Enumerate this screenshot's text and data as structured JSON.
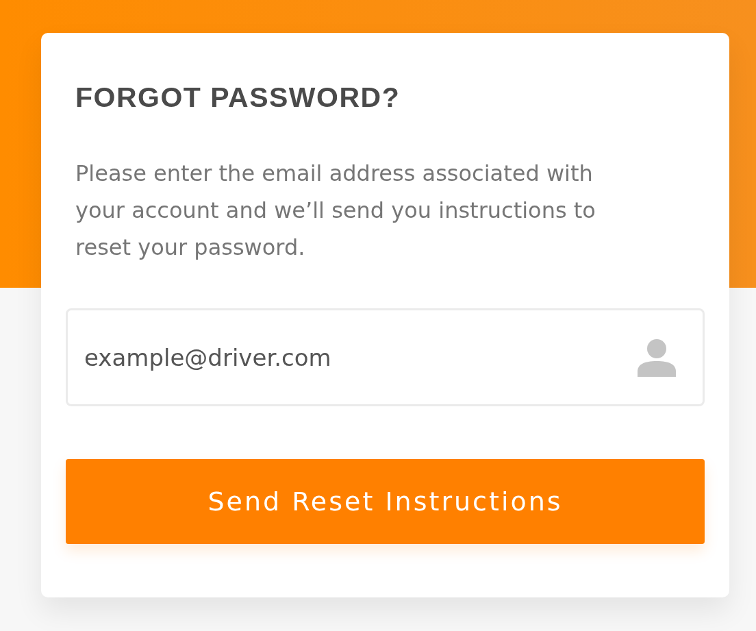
{
  "title": "FORGOT PASSWORD?",
  "description": "Please enter the email address associated with your account and we’ll send you instructions to reset your password.",
  "email_field": {
    "value": "example@driver.com"
  },
  "button": {
    "label": "Send Reset Instructions"
  }
}
